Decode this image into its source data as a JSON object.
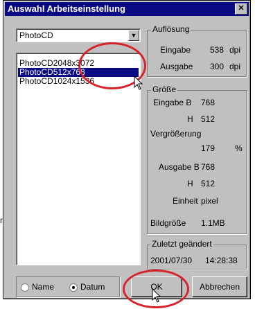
{
  "window": {
    "title": "Auswahl Arbeitseinstellung",
    "close": "✕"
  },
  "dropdown": {
    "value": "PhotoCD",
    "arrow": "▼"
  },
  "list": {
    "items": [
      {
        "label": "PhotoCD2048x3072",
        "selected": false
      },
      {
        "label": "PhotoCD512x768",
        "selected": true
      },
      {
        "label": "PhotoCD1024x1536",
        "selected": false
      }
    ]
  },
  "aufloesung": {
    "title": "Auflösung",
    "eingabe_label": "Eingabe",
    "eingabe_value": "538",
    "eingabe_unit": "dpi",
    "ausgabe_label": "Ausgabe",
    "ausgabe_value": "300",
    "ausgabe_unit": "dpi"
  },
  "groesse": {
    "title": "Größe",
    "eingabe_b_label": "Eingabe B",
    "eingabe_b_value": "768",
    "eingabe_h_label": "H",
    "eingabe_h_value": "512",
    "vergr_label": "Vergrößerung",
    "vergr_value": "179",
    "vergr_unit": "%",
    "ausgabe_b_label": "Ausgabe B",
    "ausgabe_b_value": "768",
    "ausgabe_h_label": "H",
    "ausgabe_h_value": "512",
    "einheit_label": "Einheit",
    "einheit_value": "pixel",
    "bildgroesse_label": "Bildgröße",
    "bildgroesse_value": "1.1MB"
  },
  "changed": {
    "title": "Zuletzt geändert",
    "date": "2001/07/30",
    "time": "14:28:38"
  },
  "sort": {
    "name_label": "Name",
    "datum_label": "Datum",
    "selected": "Datum"
  },
  "buttons": {
    "ok": "OK",
    "cancel": "Abbrechen"
  },
  "side_glyph": "n",
  "colors": {
    "titlebar": "#0a0a84",
    "highlight": "#d8232a",
    "face": "#c0c0c0"
  }
}
